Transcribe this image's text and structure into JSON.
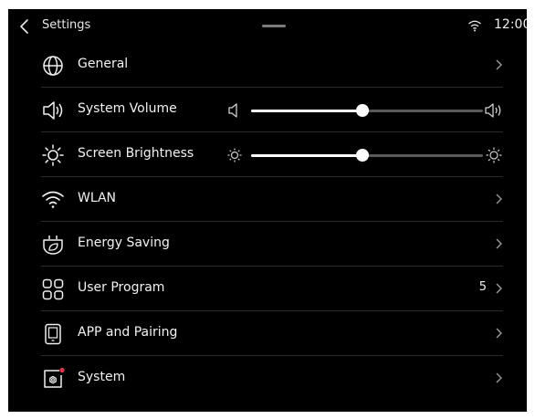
{
  "header": {
    "title": "Settings",
    "time": "12:00",
    "back_icon": "chevron-left-icon",
    "wifi_icon": "wifi-icon"
  },
  "items": [
    {
      "label": "General",
      "icon": "globe-icon",
      "type": "link"
    },
    {
      "label": "System Volume",
      "icon": "speaker-icon",
      "type": "slider",
      "value": 0.48
    },
    {
      "label": "Screen Brightness",
      "icon": "sun-icon",
      "type": "slider",
      "value": 0.48
    },
    {
      "label": "WLAN",
      "icon": "wifi-icon",
      "type": "link"
    },
    {
      "label": "Energy Saving",
      "icon": "leaf-plug-icon",
      "type": "link"
    },
    {
      "label": "User Program",
      "icon": "grid-icon",
      "type": "link",
      "value": "5"
    },
    {
      "label": "APP and Pairing",
      "icon": "tablet-icon",
      "type": "link"
    },
    {
      "label": "System",
      "icon": "system-gear-icon",
      "type": "link",
      "badge": true,
      "badge_color": "#e8324a"
    }
  ],
  "colors": {
    "background": "#000000",
    "text": "#f2f2f2",
    "track": "#5a5a5a",
    "divider": "#2b2b2b"
  }
}
